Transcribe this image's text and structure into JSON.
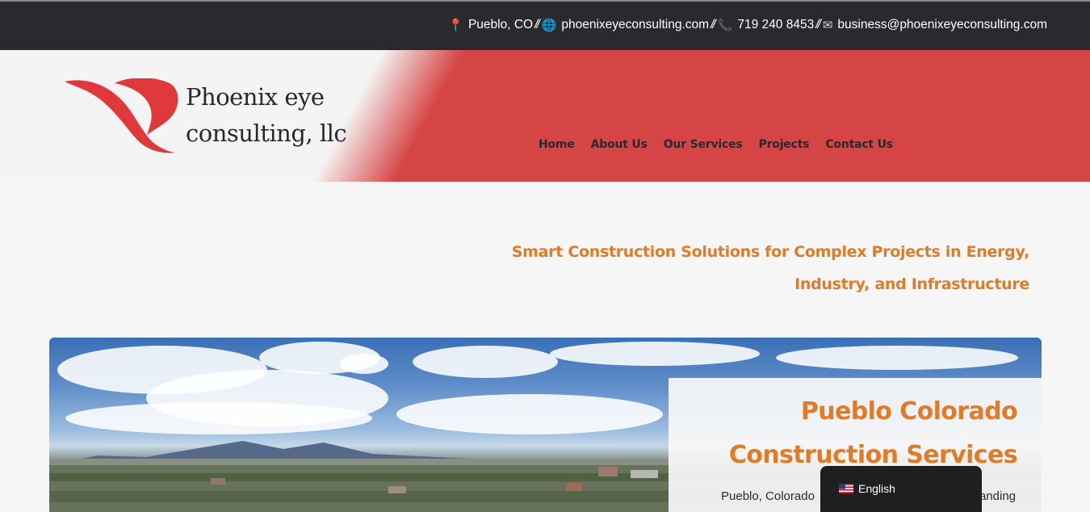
{
  "topbar": {
    "location": "Pueblo, CO",
    "website": "phoenixeyeconsulting.com",
    "phone": "719 240 8453",
    "email": "business@phoenixeyeconsulting.com",
    "separator": "//",
    "icons": [
      "pin-icon",
      "globe-icon",
      "phone-icon",
      "mail-icon"
    ]
  },
  "brand": {
    "line1": "Phoenix eye",
    "line2": "consulting, llc",
    "logo_color": "#e0393b"
  },
  "nav": {
    "items": [
      "Home",
      "About Us",
      "Our Services",
      "Projects",
      "Contact Us"
    ]
  },
  "tagline": {
    "line1": "Smart Construction Solutions for Complex Projects in Energy,",
    "line2": "Industry, and Infrastructure"
  },
  "hero": {
    "title_line1": "Pueblo Colorado",
    "title_line2": "Construction Services",
    "text_start": "Pueblo, Colorado",
    "text_end": "anding"
  },
  "language": {
    "label": "English",
    "flag": "us-flag-icon"
  },
  "colors": {
    "accent": "#e07b27",
    "brand_red": "#d64545",
    "topbar_bg": "#2a292e"
  }
}
